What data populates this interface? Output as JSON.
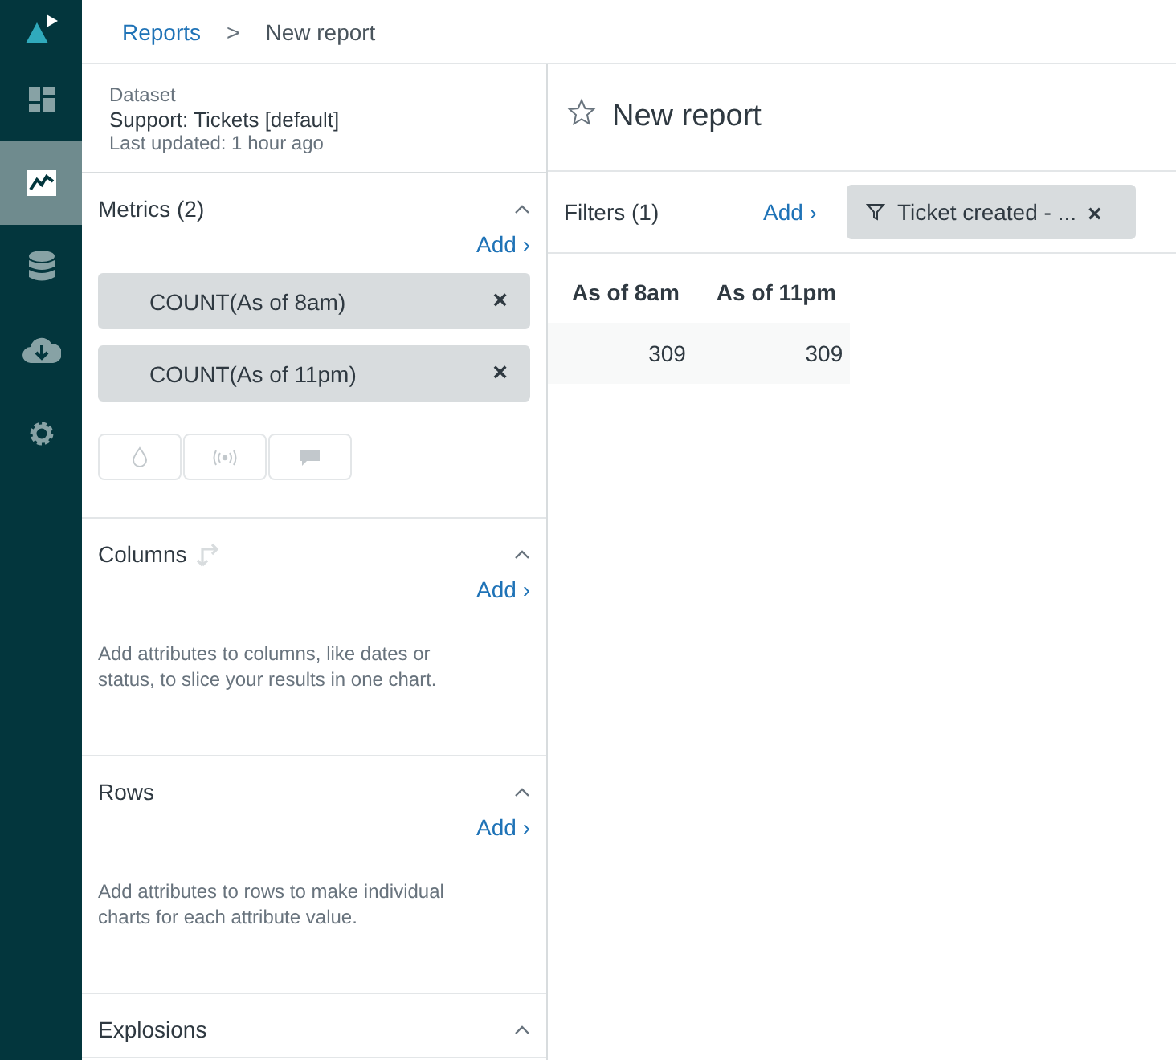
{
  "nav": {
    "items": [
      {
        "selected": false
      },
      {
        "selected": true
      },
      {
        "selected": false
      },
      {
        "selected": false
      },
      {
        "selected": false
      }
    ]
  },
  "breadcrumb": {
    "link": "Reports",
    "separator": ">",
    "current": "New report"
  },
  "dataset": {
    "label": "Dataset",
    "name": "Support: Tickets [default]",
    "updated": "Last updated: 1 hour ago"
  },
  "sections": [
    {
      "title": "Metrics (2)",
      "add": "Add ›",
      "expanded": true,
      "chips": [
        "COUNT(As of 8am)",
        "COUNT(As of 11pm)"
      ],
      "remove": "×"
    },
    {
      "title": "Columns",
      "add": "Add ›",
      "expanded": true,
      "swap": true,
      "hint": "Add attributes to columns, like dates or status, to slice your results in one chart."
    },
    {
      "title": "Rows",
      "add": "Add ›",
      "expanded": true,
      "hint": "Add attributes to rows to make individual charts for each attribute value."
    },
    {
      "title": "Explosions",
      "expanded": true
    }
  ],
  "report": {
    "title": "New report",
    "starred": false
  },
  "filters": {
    "label": "Filters (1)",
    "add": "Add ›",
    "chip": "Ticket created - ...",
    "remove": "×"
  },
  "table": {
    "columns": [
      "As of 8am",
      "As of 11pm"
    ],
    "rows": [
      [
        "309",
        "309"
      ]
    ]
  }
}
